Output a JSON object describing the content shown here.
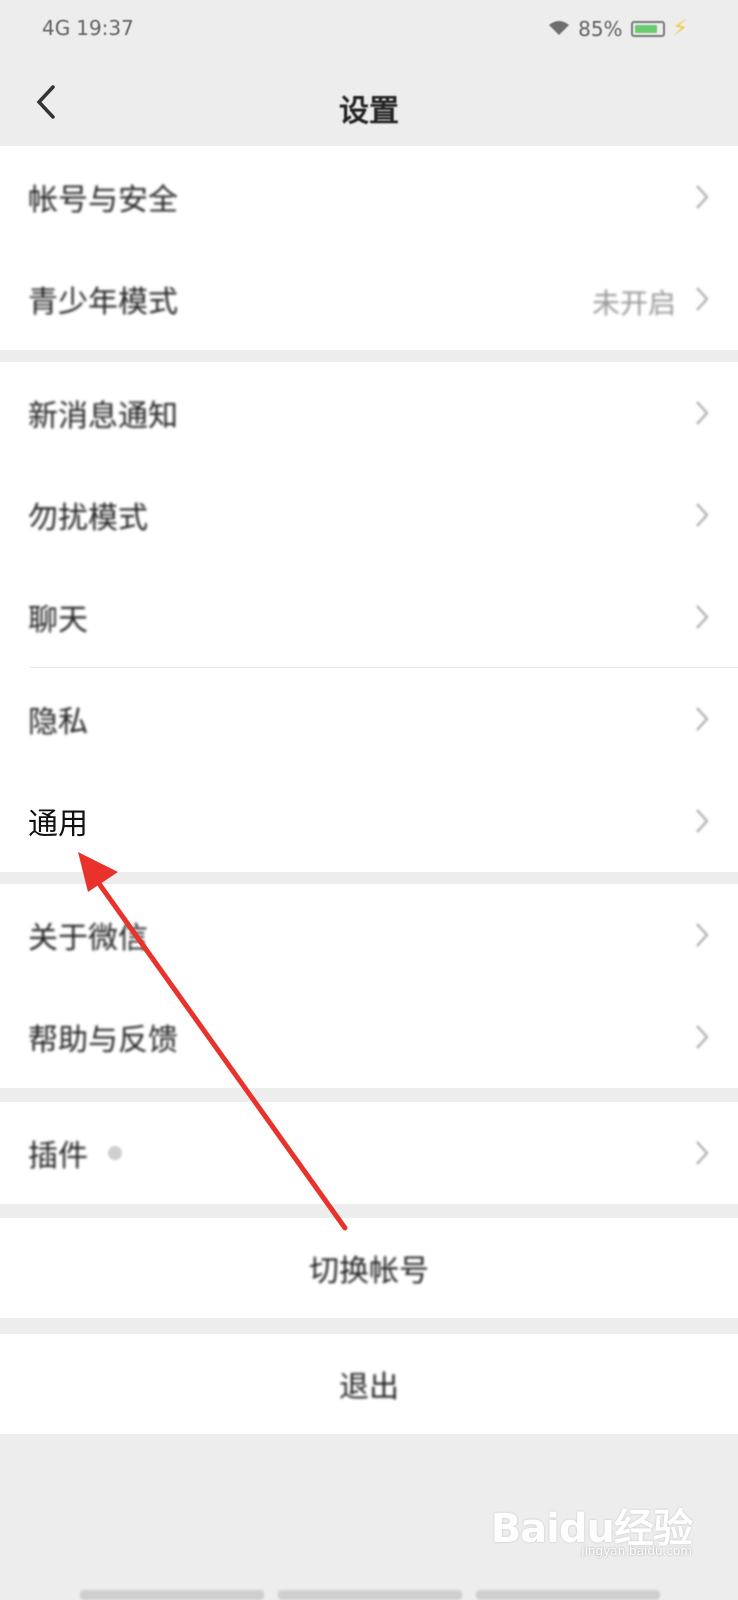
{
  "status_bar": {
    "time": "19:37",
    "carrier": "4G",
    "battery_text": "85%",
    "battery_level": 0.85
  },
  "nav": {
    "title": "设置"
  },
  "groups": [
    {
      "items": [
        {
          "label": "帐号与安全",
          "value": ""
        },
        {
          "label": "青少年模式",
          "value": "未开启"
        }
      ]
    },
    {
      "items": [
        {
          "label": "新消息通知",
          "value": ""
        },
        {
          "label": "勿扰模式",
          "value": ""
        },
        {
          "label": "聊天",
          "value": ""
        },
        {
          "label": "隐私",
          "value": ""
        },
        {
          "label": "通用",
          "value": ""
        }
      ]
    },
    {
      "items": [
        {
          "label": "关于微信",
          "value": ""
        },
        {
          "label": "帮助与反馈",
          "value": ""
        }
      ]
    },
    {
      "items": [
        {
          "label": "插件",
          "value": ""
        }
      ]
    }
  ],
  "actions": {
    "switch_account": "切换帐号",
    "logout": "退出"
  },
  "watermark": {
    "logo": "Baidu经验",
    "sub": "jingyan.baidu.com"
  },
  "colors": {
    "background": "#ededed",
    "cell": "#ffffff",
    "annotation_arrow": "#e8322b",
    "battery": "#3fc04a"
  },
  "icons": {
    "back": "chevron-left-icon",
    "row": "chevron-right-icon"
  }
}
